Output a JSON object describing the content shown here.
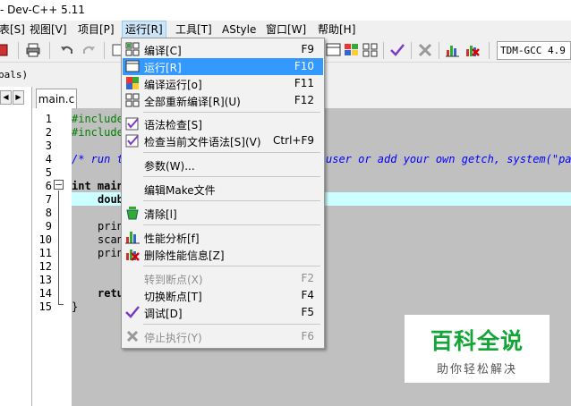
{
  "window": {
    "title": "- Dev-C++ 5.11"
  },
  "menubar": {
    "items": [
      {
        "label": "表[S]"
      },
      {
        "label": "视图[V]"
      },
      {
        "label": "项目[P]"
      },
      {
        "label": "运行[R]"
      },
      {
        "label": "工具[T]"
      },
      {
        "label": "AStyle"
      },
      {
        "label": "窗口[W]"
      },
      {
        "label": "帮助[H]"
      }
    ]
  },
  "toolbar": {
    "compiler": "TDM-GCC 4.9"
  },
  "classbar": {
    "label": "pals)"
  },
  "editor": {
    "tab": "main.c",
    "line_numbers": [
      "1",
      "2",
      "3",
      "4",
      "5",
      "6",
      "7",
      "8",
      "9",
      "10",
      "11",
      "12",
      "13",
      "14",
      "15"
    ],
    "code": {
      "l1": "#include",
      "l2": "#include",
      "l4a": "/* run t",
      "l4b": "user or add your own getch, system(\"paus",
      "l6": "int main",
      "l7": "doub",
      "l9": "prin",
      "l10": "scan",
      "l11": "prin",
      "l14": "retu",
      "l15": "}"
    }
  },
  "run_menu": {
    "items": [
      {
        "label": "编译[C]",
        "shortcut": "F9",
        "icon": "compile-icon"
      },
      {
        "label": "运行[R]",
        "shortcut": "F10",
        "icon": "run-icon"
      },
      {
        "label": "编译运行[o]",
        "shortcut": "F11",
        "icon": "compile-run-icon"
      },
      {
        "label": "全部重新编译[R](U)",
        "shortcut": "F12",
        "icon": "rebuild-all-icon"
      },
      {
        "label": "语法检查[S]",
        "shortcut": "",
        "icon": "syntax-check-icon"
      },
      {
        "label": "检查当前文件语法[S](V)",
        "shortcut": "Ctrl+F9",
        "icon": "syntax-check-file-icon"
      },
      {
        "label": "参数(W)...",
        "shortcut": ""
      },
      {
        "label": "编辑Make文件",
        "shortcut": ""
      },
      {
        "label": "清除[l]",
        "shortcut": "",
        "icon": "clean-icon"
      },
      {
        "label": "性能分析[f]",
        "shortcut": "",
        "icon": "profile-icon"
      },
      {
        "label": "删除性能信息[Z]",
        "shortcut": "",
        "icon": "delete-profile-icon"
      },
      {
        "label": "转到断点(X)",
        "shortcut": "F2"
      },
      {
        "label": "切换断点[T]",
        "shortcut": "F4"
      },
      {
        "label": "调试[D]",
        "shortcut": "F5",
        "icon": "debug-check-icon"
      },
      {
        "label": "停止执行(Y)",
        "shortcut": "F6",
        "icon": "stop-icon"
      }
    ]
  },
  "watermark": {
    "title": "百科全说",
    "subtitle": "助你轻松解决"
  }
}
